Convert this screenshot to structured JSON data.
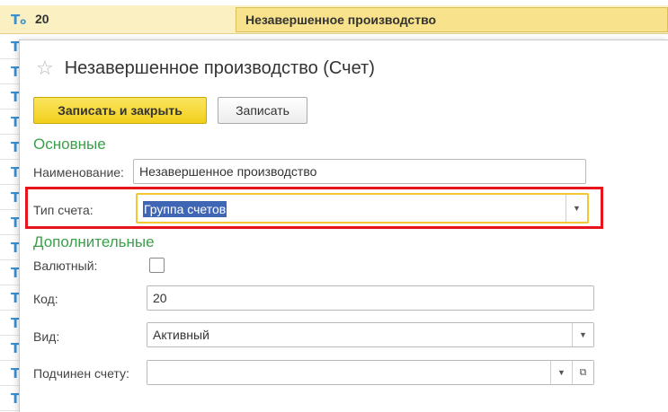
{
  "background_list": {
    "selected_row": {
      "code": "20",
      "name": "Незавершенное производство"
    }
  },
  "dialog": {
    "title": "Незавершенное производство (Счет)",
    "buttons": {
      "save_close_label": "Записать и закрыть",
      "save_label": "Записать"
    },
    "sections": {
      "main_label": "Основные",
      "additional_label": "Дополнительные"
    },
    "fields": {
      "name_label": "Наименование:",
      "name_value": "Незавершенное производство",
      "type_label": "Тип счета:",
      "type_value": "Группа счетов",
      "currency_label": "Валютный:",
      "currency_checked": false,
      "code_label": "Код:",
      "code_value": "20",
      "kind_label": "Вид:",
      "kind_value": "Активный",
      "parent_label": "Подчинен счету:",
      "parent_value": ""
    }
  },
  "colors": {
    "accent_section": "#3aa04a",
    "primary_button": "#f2cf1d",
    "highlight_frame": "#e8141c",
    "selection": "#3f66b5"
  },
  "icons": {
    "account_type": "T-icon",
    "favorite": "star-icon",
    "dropdown": "chevron-down-icon",
    "open": "open-form-icon"
  }
}
